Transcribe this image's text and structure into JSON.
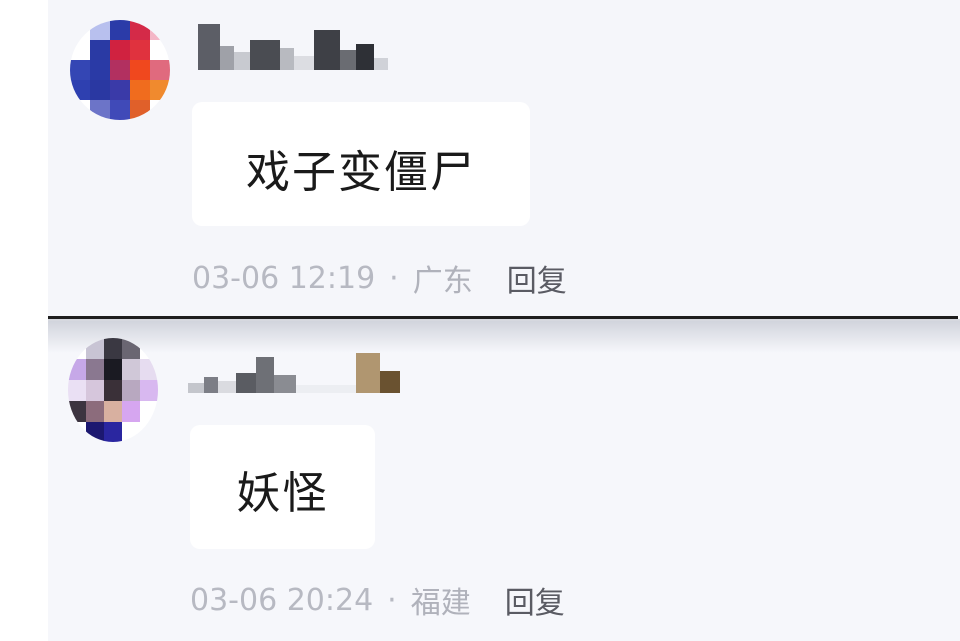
{
  "comments": [
    {
      "username": "",
      "content": "戏子变僵尸",
      "date": "03-06 12:19",
      "separator": "·",
      "location": "广东",
      "reply_label": "回复",
      "avatar_pixels": [
        [
          "#ffffff",
          "#b8c0ee",
          "#2b3ba8",
          "#d42a48",
          "#f4b6c6"
        ],
        [
          "#ffffff",
          "#2a3aa4",
          "#d02240",
          "#e0323e",
          "#ffffff"
        ],
        [
          "#3446b4",
          "#2a3aa6",
          "#b23060",
          "#f0481e",
          "#e06a7e"
        ],
        [
          "#2e40b0",
          "#2a38a2",
          "#3a3aa8",
          "#f06c1e",
          "#f08a2e"
        ],
        [
          "#ffffff",
          "#6c74c8",
          "#404ab8",
          "#e0602a",
          "#ffffff"
        ]
      ],
      "name_pixels": [
        {
          "w": 22,
          "h": 46,
          "c": "#5c5e66"
        },
        {
          "w": 14,
          "h": 24,
          "c": "#9fa1a8"
        },
        {
          "w": 16,
          "h": 18,
          "c": "#c8cad0"
        },
        {
          "w": 30,
          "h": 30,
          "c": "#4a4c52"
        },
        {
          "w": 14,
          "h": 22,
          "c": "#b8bac0"
        },
        {
          "w": 20,
          "h": 14,
          "c": "#dcdde2"
        },
        {
          "w": 26,
          "h": 40,
          "c": "#3e4046"
        },
        {
          "w": 16,
          "h": 20,
          "c": "#6a6c72"
        },
        {
          "w": 18,
          "h": 26,
          "c": "#2e3036"
        },
        {
          "w": 14,
          "h": 12,
          "c": "#d0d2d8"
        }
      ]
    },
    {
      "username": "",
      "content": "妖怪",
      "date": "03-06 20:24",
      "separator": "·",
      "location": "福建",
      "reply_label": "回复",
      "avatar_pixels": [
        [
          "#ffffff",
          "#c8c4d4",
          "#3a3842",
          "#6a6672",
          "#ffffff"
        ],
        [
          "#c6a8e8",
          "#8a7890",
          "#1a1a22",
          "#d0c8d8",
          "#e6dcf0"
        ],
        [
          "#eae0f4",
          "#d6c6dc",
          "#3a3038",
          "#b8a8c0",
          "#d8b8f0"
        ],
        [
          "#3c3440",
          "#8c6c7c",
          "#d8b0a0",
          "#d6a6f0",
          "#ffffff"
        ],
        [
          "#ffffff",
          "#1c1870",
          "#2a26a0",
          "#ffffff",
          "#ffffff"
        ]
      ],
      "name_pixels": [
        {
          "w": 16,
          "h": 10,
          "c": "#c4c6cc"
        },
        {
          "w": 14,
          "h": 16,
          "c": "#7c7e86"
        },
        {
          "w": 18,
          "h": 12,
          "c": "#dadbe0"
        },
        {
          "w": 20,
          "h": 20,
          "c": "#5a5c62"
        },
        {
          "w": 18,
          "h": 36,
          "c": "#6e7076"
        },
        {
          "w": 22,
          "h": 18,
          "c": "#8a8c92"
        },
        {
          "w": 60,
          "h": 8,
          "c": "#eceef2"
        },
        {
          "w": 24,
          "h": 40,
          "c": "#b09670"
        },
        {
          "w": 20,
          "h": 22,
          "c": "#6a5230"
        }
      ]
    }
  ],
  "colors": {
    "background": "#f5f6fa",
    "bubble": "#ffffff",
    "meta_text": "#b7b9c2",
    "reply_text": "#5a5b63",
    "content_text": "#1a1a1a",
    "divider": "#1e1e1e"
  }
}
